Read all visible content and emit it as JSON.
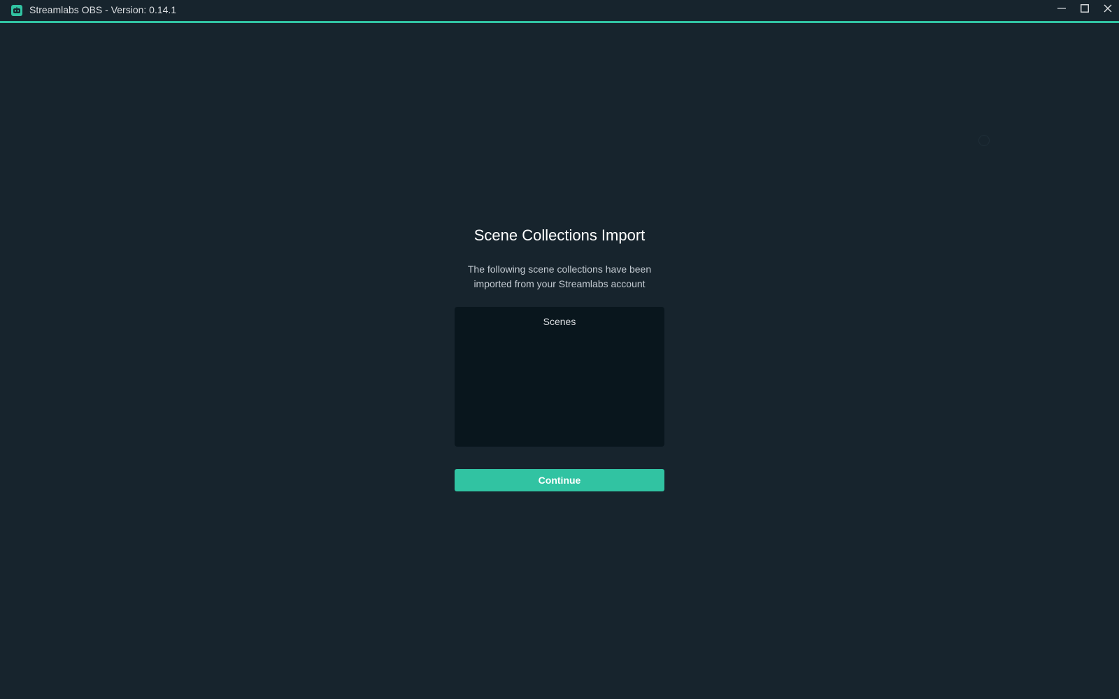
{
  "window": {
    "title": "Streamlabs OBS - Version: 0.14.1",
    "app_icon": "streamlabs-robot-icon",
    "controls": [
      "minimize-icon",
      "maximize-icon",
      "close-icon"
    ],
    "accent_color": "#31c3a2",
    "background_color": "#17242d"
  },
  "import_dialog": {
    "heading": "Scene Collections Import",
    "description_line1": "The following scene collections have been",
    "description_line2": "imported from your Streamlabs account",
    "collections": [
      "Scenes"
    ],
    "continue_label": "Continue"
  }
}
